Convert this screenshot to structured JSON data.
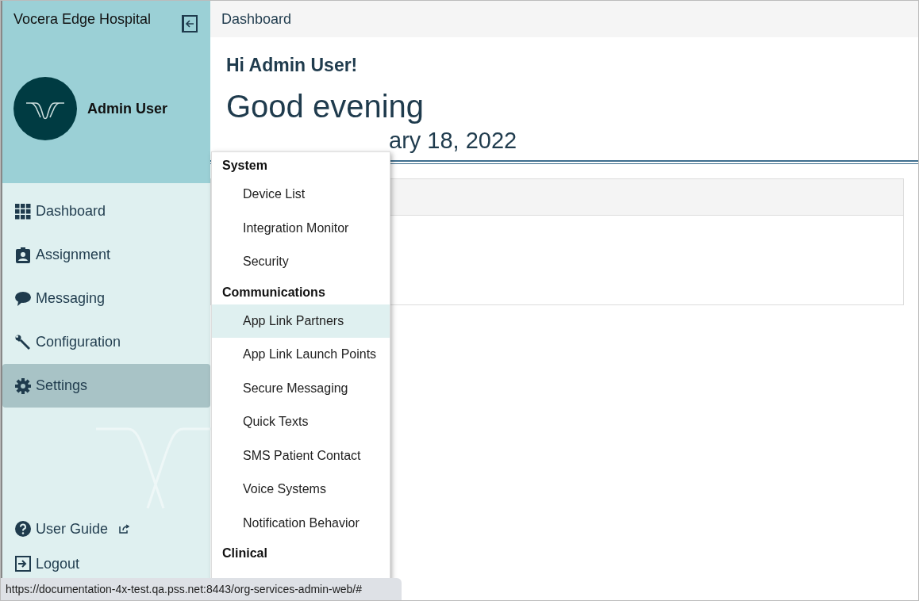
{
  "sidebar": {
    "org_name": "Vocera Edge Hospital",
    "user_name": "Admin User",
    "nav": [
      {
        "label": "Dashboard",
        "kind": "grid",
        "selected": false
      },
      {
        "label": "Assignment",
        "kind": "badge",
        "selected": false
      },
      {
        "label": "Messaging",
        "kind": "chat",
        "selected": false
      },
      {
        "label": "Configuration",
        "kind": "wrench",
        "selected": false
      },
      {
        "label": "Settings",
        "kind": "gear",
        "selected": true
      }
    ],
    "footer": [
      {
        "label": "User Guide",
        "kind": "guide"
      },
      {
        "label": "Logout",
        "kind": "logout"
      }
    ]
  },
  "header": {
    "title": "Dashboard"
  },
  "greeting": {
    "hello": "Hi Admin User!",
    "salutation": "Good evening",
    "date": "ary 18, 2022"
  },
  "settings_menu": [
    {
      "kind": "heading",
      "label": "System"
    },
    {
      "kind": "item",
      "label": "Device List",
      "selected": false
    },
    {
      "kind": "item",
      "label": "Integration Monitor",
      "selected": false
    },
    {
      "kind": "item",
      "label": "Security",
      "selected": false
    },
    {
      "kind": "heading",
      "label": "Communications"
    },
    {
      "kind": "item",
      "label": "App Link Partners",
      "selected": true
    },
    {
      "kind": "item",
      "label": "App Link Launch Points",
      "selected": false
    },
    {
      "kind": "item",
      "label": "Secure Messaging",
      "selected": false
    },
    {
      "kind": "item",
      "label": "Quick Texts",
      "selected": false
    },
    {
      "kind": "item",
      "label": "SMS Patient Contact",
      "selected": false
    },
    {
      "kind": "item",
      "label": "Voice Systems",
      "selected": false
    },
    {
      "kind": "item",
      "label": "Notification Behavior",
      "selected": false
    },
    {
      "kind": "heading",
      "label": "Clinical"
    }
  ],
  "status_bar": {
    "url": "https://documentation-4x-test.qa.pss.net:8443/org-services-admin-web/#"
  }
}
